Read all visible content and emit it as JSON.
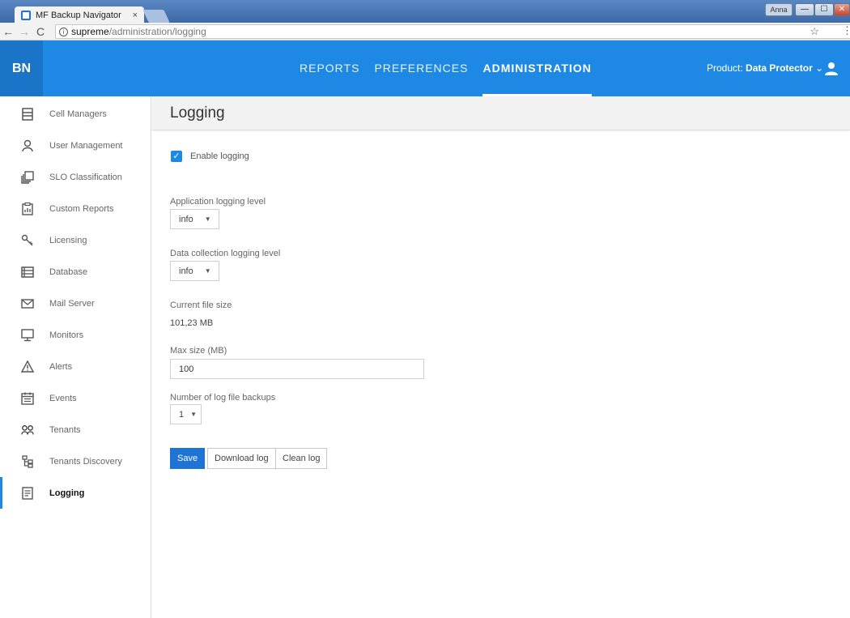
{
  "browser": {
    "tab_title": "MF Backup Navigator",
    "tab_close": "×",
    "url_host": "supreme",
    "url_path": "/administration/logging",
    "window_user": "Anna"
  },
  "app": {
    "logo": "BN",
    "nav": [
      {
        "label": "REPORTS"
      },
      {
        "label": "PREFERENCES"
      },
      {
        "label": "ADMINISTRATION"
      }
    ],
    "product_prefix": "Product:",
    "product_value": "Data Protector",
    "product_caret": "⌄",
    "accent_color": "#1e88e5"
  },
  "sidebar": {
    "items": [
      {
        "label": "Cell Managers",
        "icon": "server-icon"
      },
      {
        "label": "User Management",
        "icon": "user-icon"
      },
      {
        "label": "SLO Classification",
        "icon": "layers-icon"
      },
      {
        "label": "Custom Reports",
        "icon": "report-icon"
      },
      {
        "label": "Licensing",
        "icon": "key-icon"
      },
      {
        "label": "Database",
        "icon": "database-icon"
      },
      {
        "label": "Mail Server",
        "icon": "mail-icon"
      },
      {
        "label": "Monitors",
        "icon": "monitor-icon"
      },
      {
        "label": "Alerts",
        "icon": "warning-icon"
      },
      {
        "label": "Events",
        "icon": "calendar-icon"
      },
      {
        "label": "Tenants",
        "icon": "group-icon"
      },
      {
        "label": "Tenants Discovery",
        "icon": "tree-icon"
      },
      {
        "label": "Logging",
        "icon": "log-icon"
      }
    ]
  },
  "page": {
    "title": "Logging",
    "enable_logging_label": "Enable logging",
    "enable_logging_checked": true,
    "app_level_label": "Application logging level",
    "app_level_value": "info",
    "data_level_label": "Data collection logging level",
    "data_level_value": "info",
    "file_size_label": "Current file size",
    "file_size_value": "101,23 MB",
    "max_size_label": "Max size (MB)",
    "max_size_value": "100",
    "backups_label": "Number of log file backups",
    "backups_value": "1",
    "save_label": "Save",
    "download_label": "Download log",
    "clean_label": "Clean log"
  }
}
